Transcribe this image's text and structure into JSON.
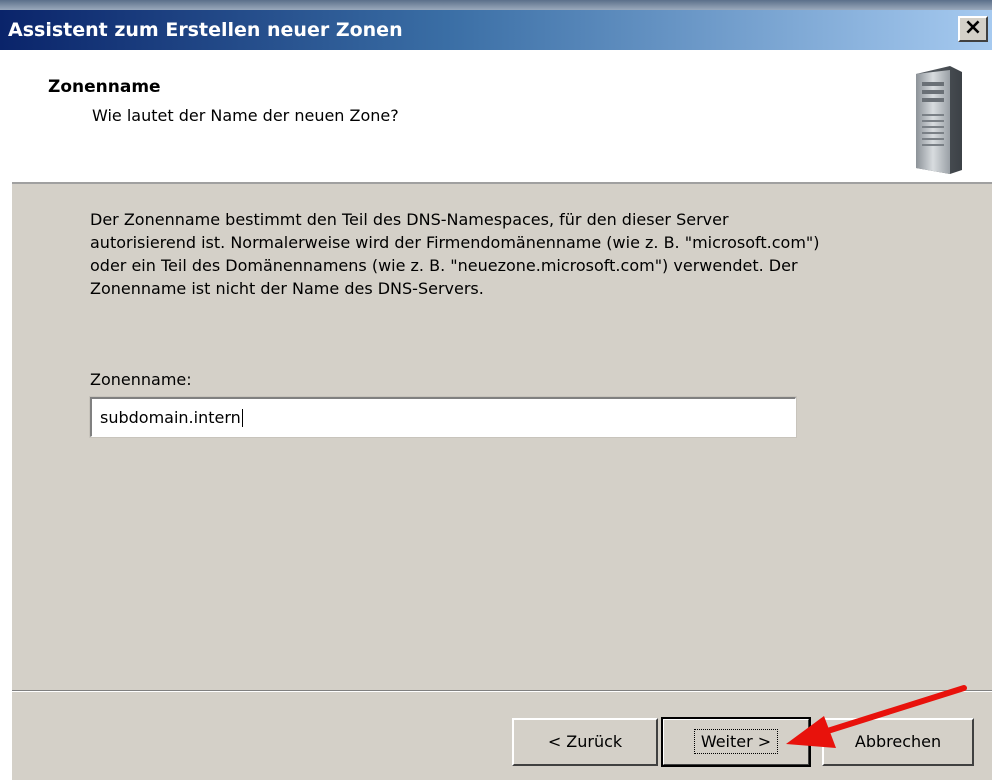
{
  "window": {
    "title": "Assistent zum Erstellen neuer Zonen",
    "close_glyph": "×"
  },
  "header": {
    "title": "Zonenname",
    "subtitle": "Wie lautet der Name der neuen Zone?",
    "icon": "server-tower-icon"
  },
  "description": {
    "lines": [
      "Der Zonenname bestimmt den Teil des DNS-Namespaces, für den dieser Server",
      "autorisierend ist. Normalerweise wird der Firmendomänenname (wie z. B. \"microsoft.com\")",
      "oder ein Teil des Domänennamens (wie z. B. \"neuezone.microsoft.com\") verwendet. Der",
      "Zonenname ist nicht der Name des DNS-Servers."
    ]
  },
  "zone_field": {
    "label": "Zonenname:",
    "value": "subdomain.intern"
  },
  "buttons": {
    "back": "< Zurück",
    "next": "Weiter >",
    "cancel": "Abbrechen"
  },
  "annotation": {
    "icon": "red-arrow-icon",
    "color": "#e8120c"
  }
}
